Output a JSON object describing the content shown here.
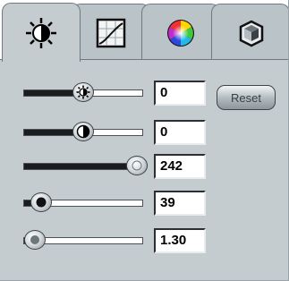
{
  "tabs": [
    {
      "id": "brightness",
      "icon": "brightness-sun-icon",
      "active": true
    },
    {
      "id": "curve",
      "icon": "curve-graph-icon",
      "active": false
    },
    {
      "id": "color",
      "icon": "color-wheel-icon",
      "active": false
    },
    {
      "id": "transform",
      "icon": "cube-transform-icon",
      "active": false
    }
  ],
  "reset_label": "Reset",
  "sliders": [
    {
      "name": "brightness",
      "icon": "sun-icon",
      "level": 0.5,
      "value": "0"
    },
    {
      "name": "contrast",
      "icon": "half-circle-icon",
      "level": 0.5,
      "value": "0"
    },
    {
      "name": "level-3",
      "icon": "knob-icon",
      "level": 0.95,
      "value": "242"
    },
    {
      "name": "level-4",
      "icon": "dark-dot-icon",
      "level": 0.15,
      "value": "39"
    },
    {
      "name": "gamma",
      "icon": "dark-dot-icon",
      "level": 0.1,
      "value": "1.30"
    }
  ],
  "colors": {
    "panel": "#c4ccd0",
    "tab": "#b9c3c8",
    "border": "#6f7a80"
  }
}
